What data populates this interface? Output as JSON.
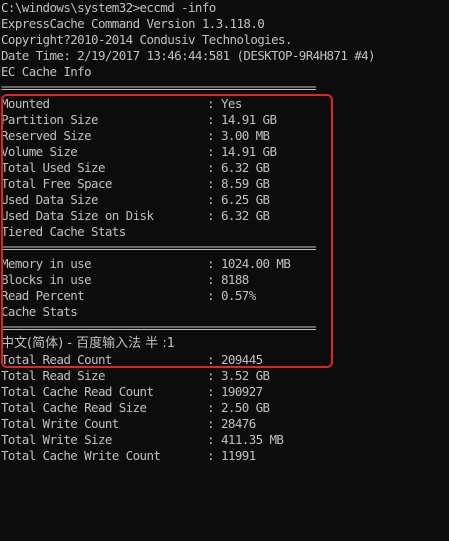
{
  "console": {
    "prompt_line": "C:\\windows\\system32>eccmd -info",
    "header": [
      "ExpressCache Command Version 1.3.118.0",
      "Copyright?2010-2014 Condusiv Technologies.",
      "Date Time: 2/19/2017 13:46:44:581 (DESKTOP-9R4H871 #4)"
    ],
    "separator": "=====================================================",
    "ec_cache_info": {
      "title": "EC Cache Info",
      "rows": [
        {
          "key": "Mounted",
          "value": "Yes"
        },
        {
          "key": "Partition Size",
          "value": "14.91 GB"
        },
        {
          "key": "Reserved Size",
          "value": "3.00 MB"
        },
        {
          "key": "Volume Size",
          "value": "14.91 GB"
        },
        {
          "key": "Total Used Size",
          "value": "6.32 GB"
        },
        {
          "key": "Total Free Space",
          "value": "8.59 GB"
        },
        {
          "key": "Used Data Size",
          "value": "6.25 GB"
        },
        {
          "key": "Used Data Size on Disk",
          "value": "6.32 GB"
        }
      ]
    },
    "tiered_cache_stats": {
      "title": "Tiered Cache Stats",
      "rows": [
        {
          "key": "Memory in use",
          "value": "1024.00 MB"
        },
        {
          "key": "Blocks in use",
          "value": "8188"
        },
        {
          "key": "Read Percent",
          "value": "0.57%"
        }
      ]
    },
    "cache_stats": {
      "title": "Cache Stats",
      "ime_line": "中文(简体) - 百度输入法 半 :1",
      "rows": [
        {
          "key": "Total Read Count",
          "value": "209445"
        },
        {
          "key": "Total Read Size",
          "value": "3.52 GB"
        },
        {
          "key": "Total Cache Read Count",
          "value": "190927"
        },
        {
          "key": "Total Cache Read Size",
          "value": "2.50 GB"
        },
        {
          "key": "Total Write Count",
          "value": "28476"
        },
        {
          "key": "Total Write Size",
          "value": "411.35 MB"
        },
        {
          "key": "Total Cache Write Count",
          "value": "11991"
        }
      ]
    },
    "kv_separator": ":",
    "colors": {
      "background": "#0c0c0c",
      "text": "#c0c0c0",
      "highlight_box": "#e0242a"
    }
  }
}
